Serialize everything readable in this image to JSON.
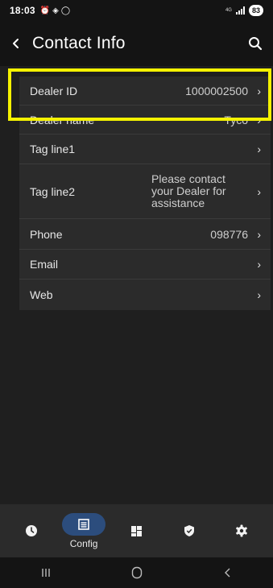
{
  "status_bar": {
    "time": "18:03",
    "notif_icons": [
      "alarm-icon",
      "location-icon",
      "whatsapp-icon"
    ],
    "network": "4G",
    "battery": "83"
  },
  "header": {
    "back_icon": "chevron-left-icon",
    "title": "Contact Info",
    "search_icon": "search-icon"
  },
  "contact_rows": [
    {
      "label": "Dealer ID",
      "value": "1000002500"
    },
    {
      "label": "Dealer name",
      "value": "Tyco"
    },
    {
      "label": "Tag line1",
      "value": ""
    },
    {
      "label": "Tag line2",
      "value": "Please contact your Dealer for assistance"
    },
    {
      "label": "Phone",
      "value": "098776"
    },
    {
      "label": "Email",
      "value": ""
    },
    {
      "label": "Web",
      "value": ""
    }
  ],
  "bottom_nav": {
    "items": [
      {
        "icon": "clock-icon",
        "label": ""
      },
      {
        "icon": "config-list-icon",
        "label": "Config",
        "active": true
      },
      {
        "icon": "dashboard-grid-icon",
        "label": ""
      },
      {
        "icon": "shield-check-icon",
        "label": ""
      },
      {
        "icon": "settings-gear-icon",
        "label": ""
      }
    ]
  },
  "system_nav": {
    "items": [
      "recents-icon",
      "home-icon",
      "back-icon"
    ]
  },
  "colors": {
    "background": "#1f1f1f",
    "card": "#2b2b2b",
    "header": "#141414",
    "active_pill": "#2c4d7d",
    "highlight": "#f5f200"
  }
}
